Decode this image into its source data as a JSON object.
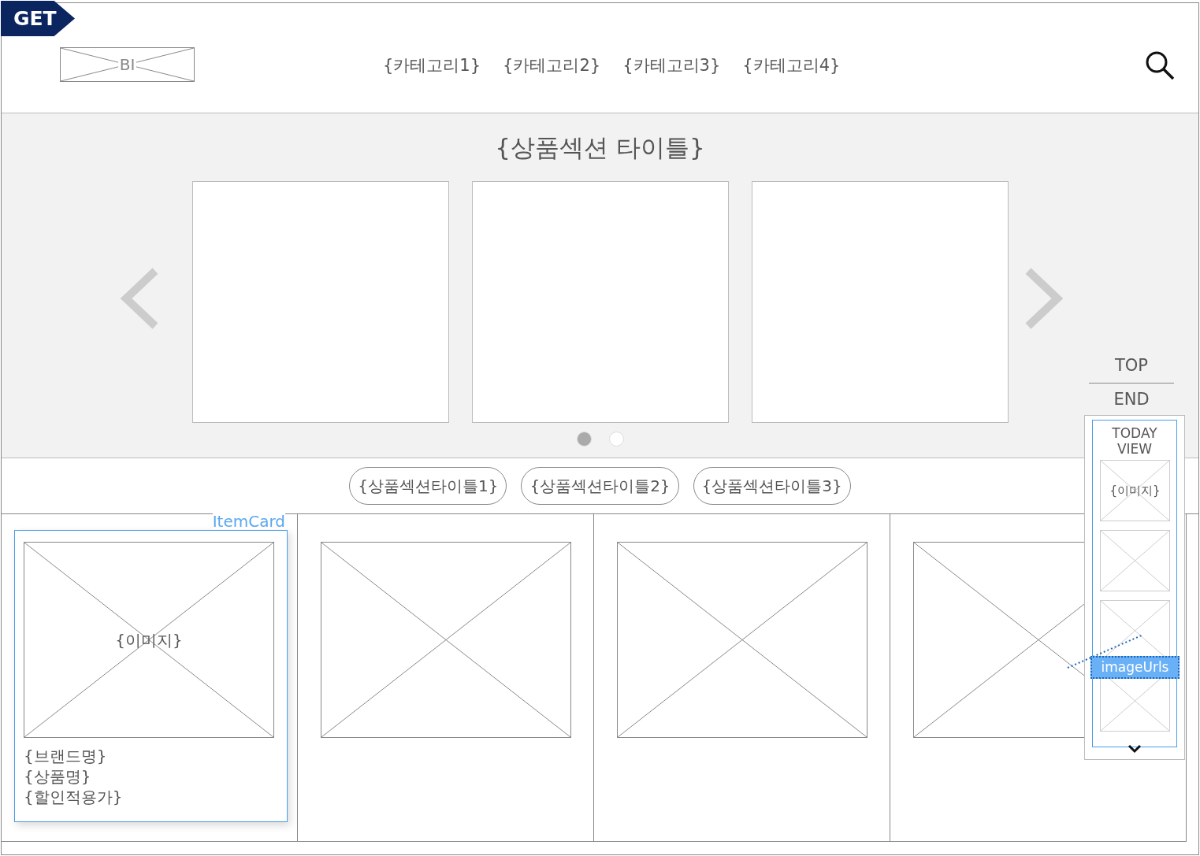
{
  "badge": "GET",
  "logo": "BI",
  "nav": [
    "{카테고리1}",
    "{카테고리2}",
    "{카테고리3}",
    "{카테고리4}"
  ],
  "carousel": {
    "title": "{상품섹션 타이틀}",
    "slides": [
      {
        "kind": "blank"
      },
      {
        "kind": "blank"
      },
      {
        "kind": "blank"
      }
    ],
    "dots": [
      {
        "selected": true
      },
      {
        "selected": false
      }
    ]
  },
  "section_tabs": [
    "{상품섹션타이틀1}",
    "{상품섹션타이틀2}",
    "{상품섹션타이틀3}"
  ],
  "cards": [
    {
      "kind": "detailed",
      "annotation": "ItemCard",
      "image": "{이미지}",
      "brand": "{브랜드명}",
      "name": "{상품명}",
      "price": "{할인적용가}"
    },
    {
      "kind": "placeholder"
    },
    {
      "kind": "placeholder"
    },
    {
      "kind": "placeholder"
    }
  ],
  "side": {
    "top": "TOP",
    "end": "END",
    "today_view": {
      "title": "TODAY VIEW",
      "annotation": "imageUrls",
      "items": [
        {
          "kind": "labeled",
          "label": "{이미지}"
        },
        {
          "kind": "blank"
        },
        {
          "kind": "blank"
        },
        {
          "kind": "blank"
        }
      ]
    }
  }
}
